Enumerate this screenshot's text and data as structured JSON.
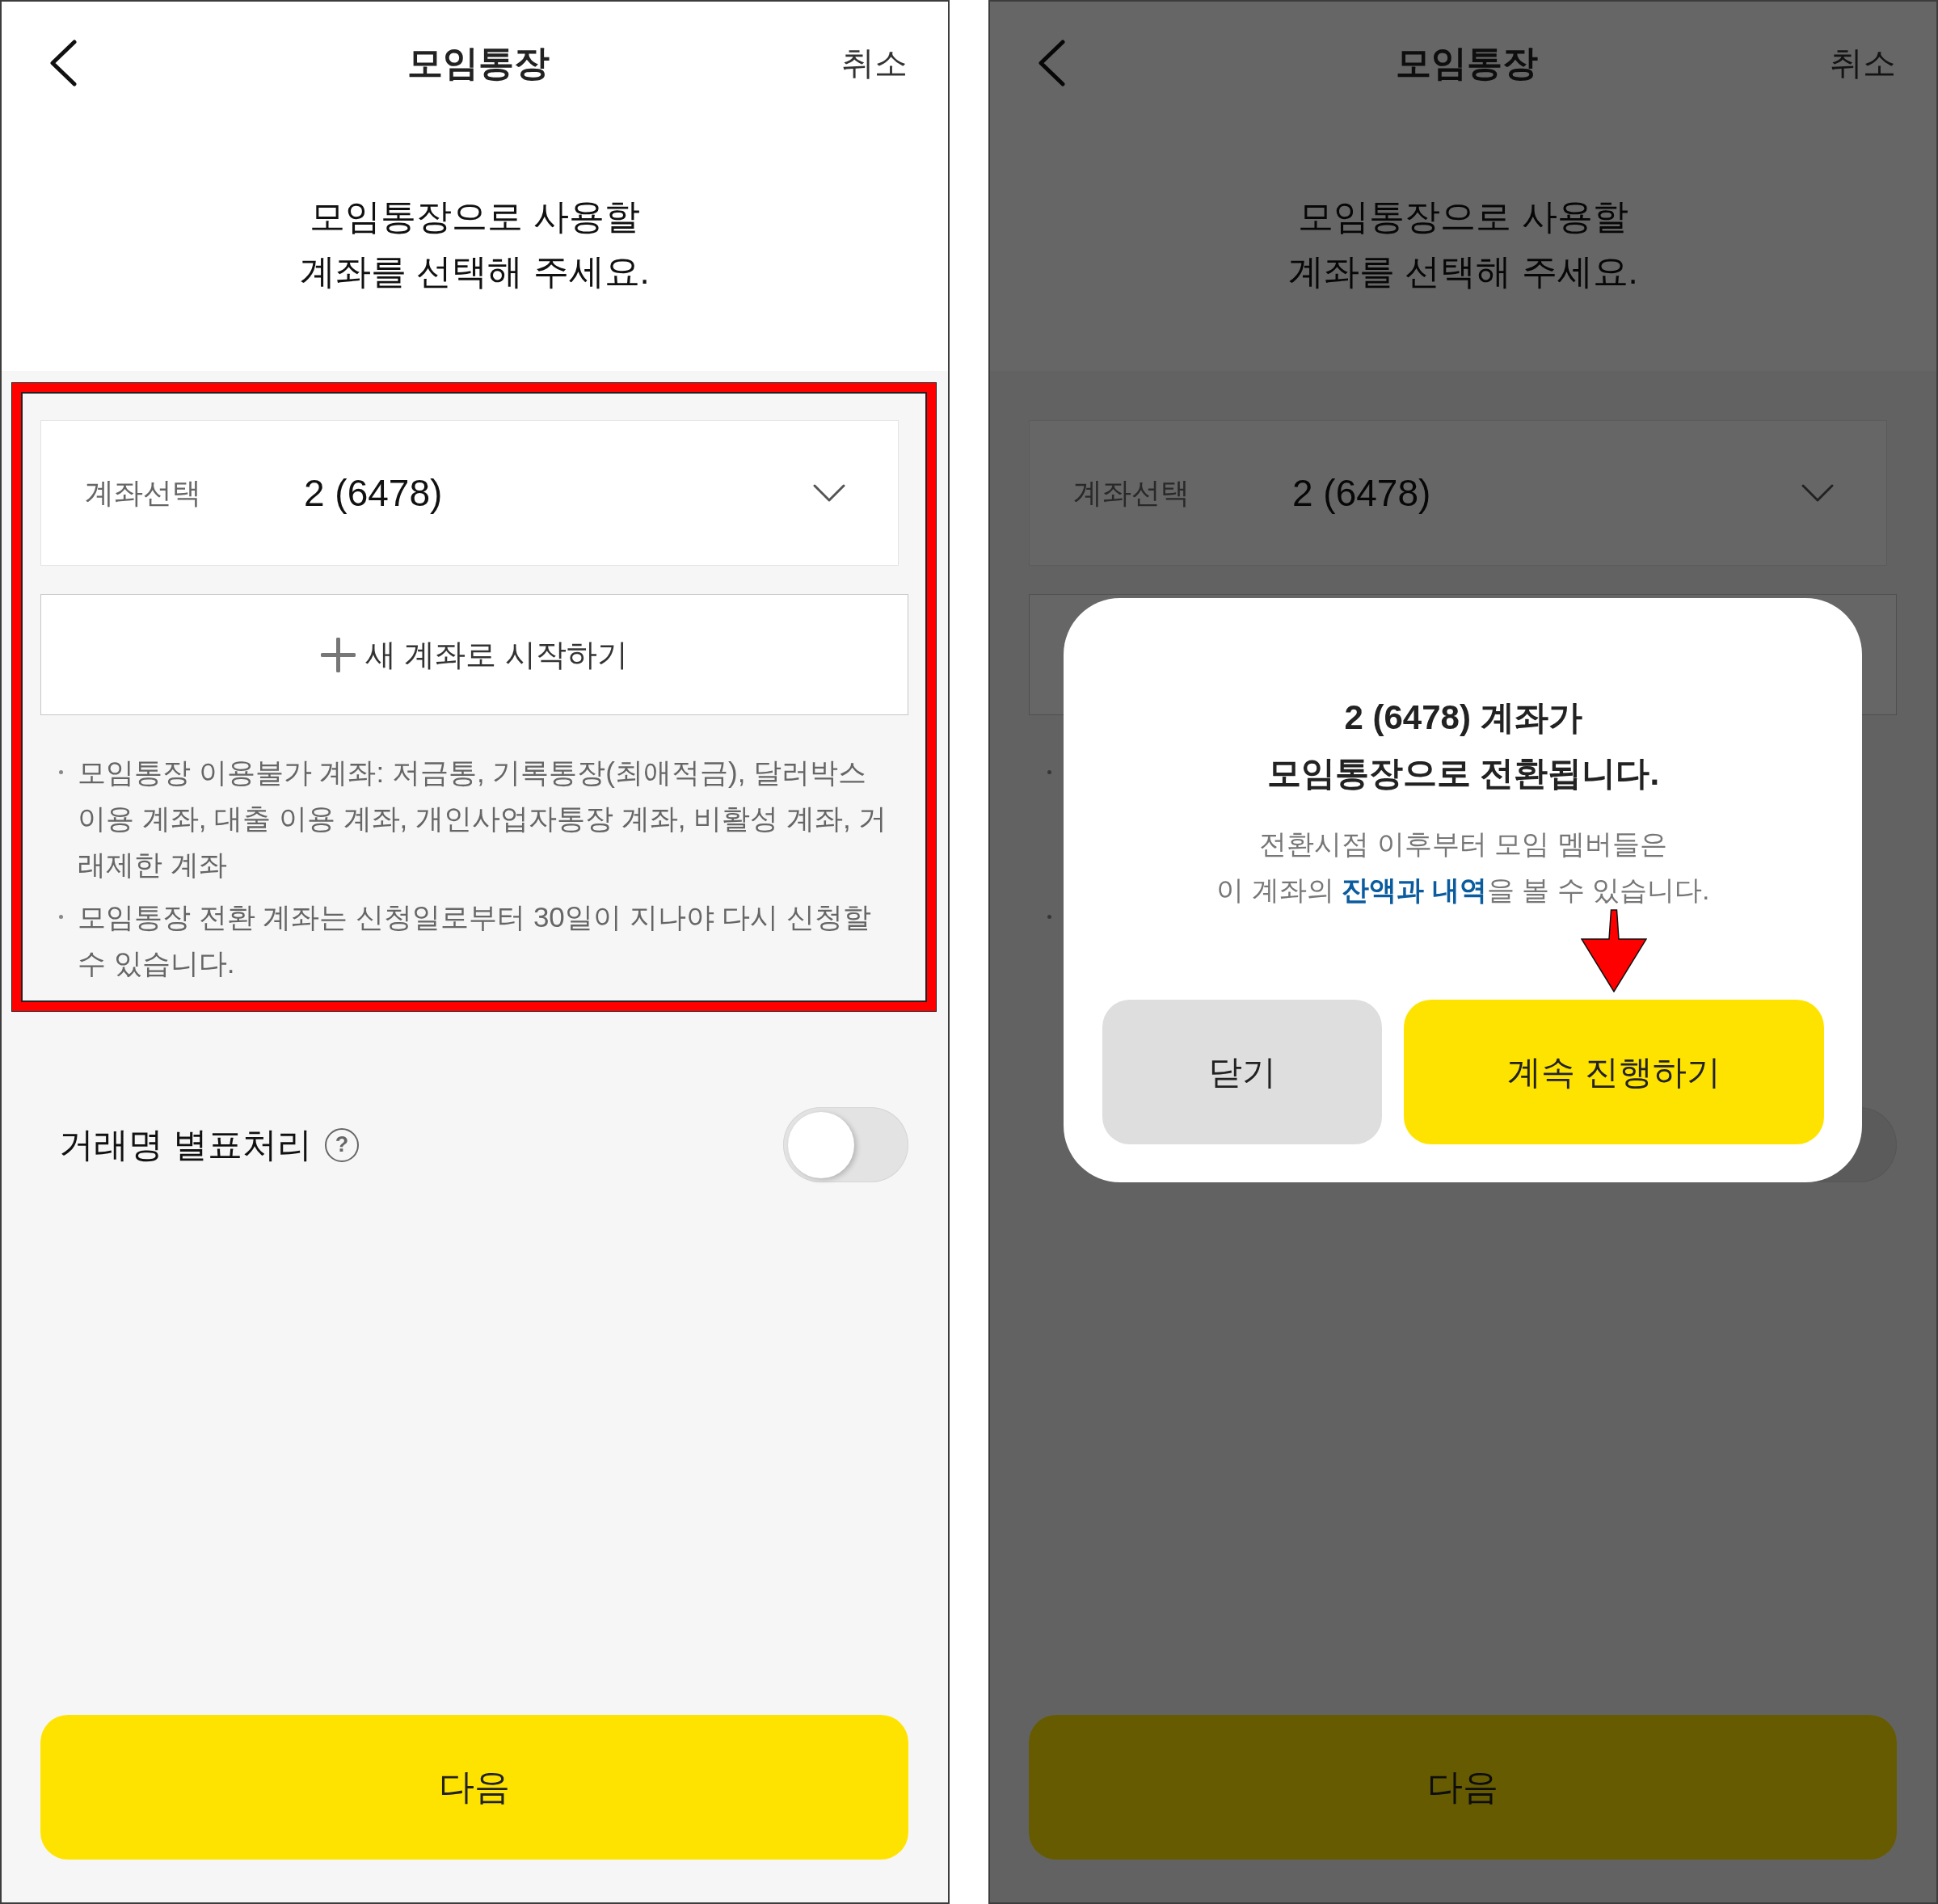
{
  "screens": [
    {
      "kind": "form",
      "dimmed": false,
      "nav": {
        "title": "모임통장",
        "cancel": "취소"
      },
      "heading": "모임통장으로 사용할\n계좌를 선택해 주세요.",
      "account_section": {
        "highlighted": true,
        "account_select": {
          "label": "계좌선택",
          "value": "2 (6478)"
        },
        "new_account_button": {
          "label": "새 계좌로 시작하기"
        },
        "notes": [
          "모임통장 이용불가 계좌: 저금통, 기록통장(최애적금), 달러박스 이용 계좌, 대출 이용 계좌, 개인사업자통장 계좌, 비활성 계좌, 거래제한 계좌",
          "모임통장 전환 계좌는 신청일로부터 30일이 지나야 다시 신청할 수 있습니다."
        ]
      },
      "masking_option": {
        "label": "거래명 별표처리",
        "help": "?",
        "on": false
      },
      "next_button": "다음"
    },
    {
      "kind": "dialog",
      "dimmed": true,
      "nav": {
        "title": "모임통장",
        "cancel": "취소"
      },
      "heading": "모임통장으로 사용할\n계좌를 선택해 주세요.",
      "account_section": {
        "highlighted": false,
        "account_select": {
          "label": "계좌선택",
          "value": "2 (6478)"
        }
      },
      "dialog": {
        "title": "2 (6478) 계좌가\n모임통장으로 전환됩니다.",
        "message": "전환시점 이후부터 모임 멤버들은\n이 계좌의 **잔액과 내역**을 볼 수 있습니다.",
        "buttons": [
          {
            "kind": "secondary",
            "label": "닫기",
            "pointed": false
          },
          {
            "kind": "primary",
            "label": "계속 진행하기",
            "pointed": true
          }
        ]
      },
      "next_button": "다음"
    }
  ]
}
